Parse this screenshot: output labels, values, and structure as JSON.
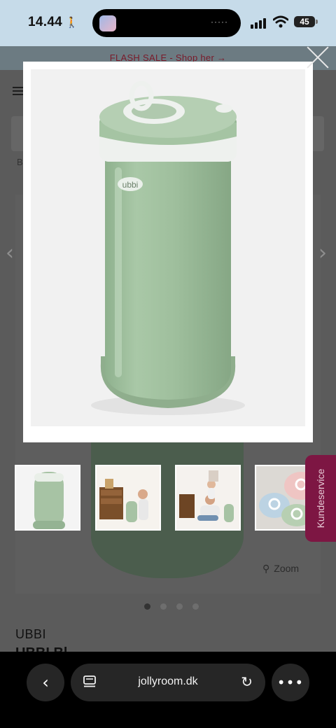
{
  "status_bar": {
    "time": "14.44",
    "battery": "45"
  },
  "banner": {
    "text": "FLASH SALE - Shop her →"
  },
  "breadcrumb": "B /",
  "product": {
    "brand": "UBBI",
    "title": "UBBI Bl...",
    "can_logo": "ubbi",
    "zoom_label": "Zoom"
  },
  "gallery": {
    "thumbnails": [
      "diaper-pail-sage",
      "nursery-dresser-baby",
      "parent-lifting-baby",
      "pastel-pails-closeup"
    ],
    "active_dot": 0,
    "dot_count": 4
  },
  "side_tab": {
    "label": "Kundeservice"
  },
  "browser": {
    "url": "jollyroom.dk"
  },
  "colors": {
    "product_green": "#9fbf9f",
    "side_tab": "#7d1643",
    "banner_text": "#7a1a2a"
  }
}
